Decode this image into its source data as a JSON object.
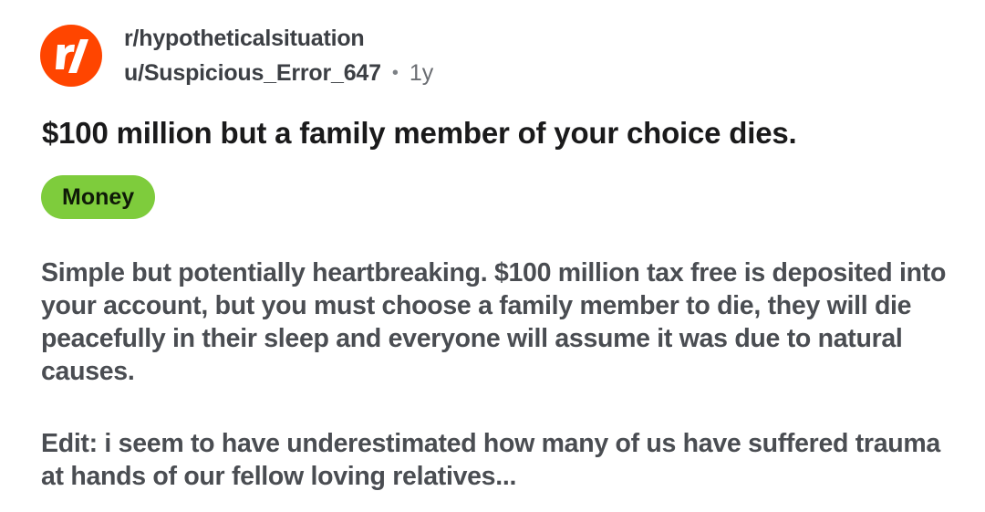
{
  "post": {
    "subreddit": "r/hypotheticalsituation",
    "username": "u/Suspicious_Error_647",
    "separator": "•",
    "age": "1y",
    "title": "$100 million but a family member of your choice dies.",
    "flair": {
      "label": "Money",
      "color": "#7ecc3c"
    },
    "body": "Simple but potentially heartbreaking. $100 million tax free is deposited into your account, but you must choose a family member to die, they will die peacefully in their sleep and everyone will assume it was due to natural causes.",
    "edit": "Edit: i seem to have underestimated how many of us have suffered trauma at hands of our fellow loving relatives..."
  },
  "icons": {
    "subreddit_avatar": "reddit-r-slash-icon"
  },
  "colors": {
    "brand": "#ff4500",
    "text_primary": "#1a1a1b",
    "text_secondary": "#4a4d52"
  }
}
